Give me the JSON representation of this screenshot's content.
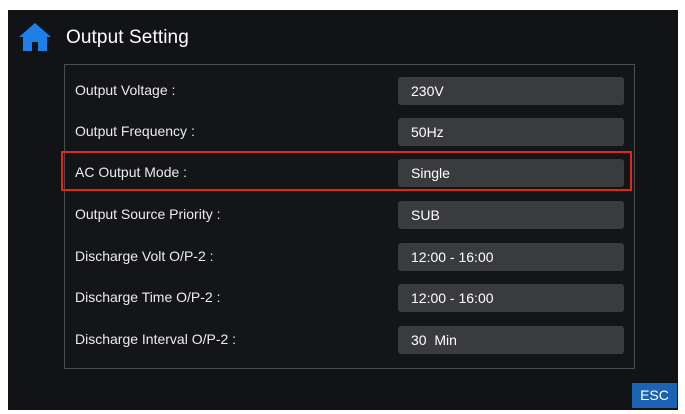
{
  "header": {
    "title": "Output Setting",
    "home_icon": "home-icon",
    "accent_color": "#1e7fe6"
  },
  "settings": [
    {
      "label": "Output Voltage :",
      "value": "230V"
    },
    {
      "label": "Output Frequency :",
      "value": "50Hz"
    },
    {
      "label": "AC Output Mode :",
      "value": "Single",
      "highlighted": true
    },
    {
      "label": "Output Source Priority :",
      "value": "SUB"
    },
    {
      "label": "Discharge Volt O/P-2 :",
      "value": "12:00 - 16:00"
    },
    {
      "label": "Discharge Time O/P-2 :",
      "value": "12:00 - 16:00"
    },
    {
      "label": "Discharge Interval O/P-2 :",
      "value": "30  Min"
    }
  ],
  "highlight_color": "#e3261d",
  "footer": {
    "esc_label": "ESC"
  }
}
